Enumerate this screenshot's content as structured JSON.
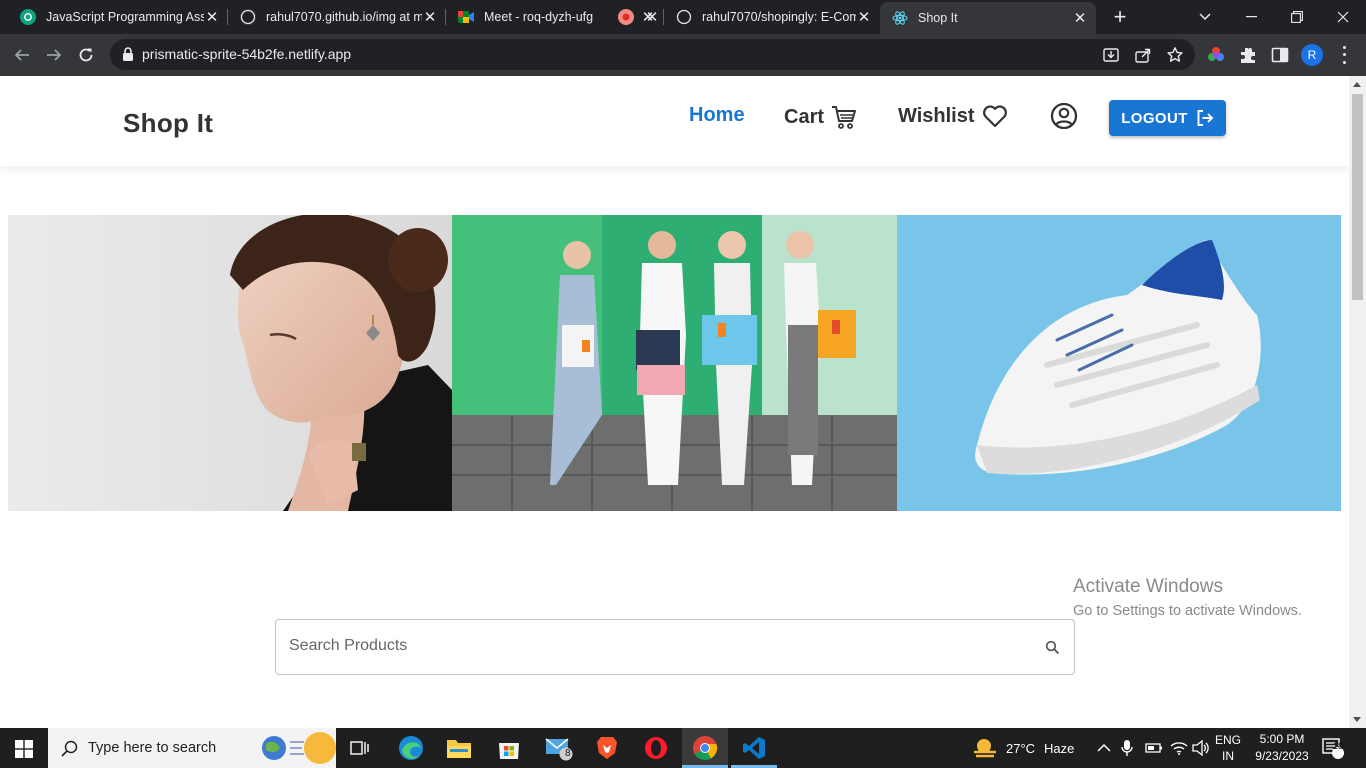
{
  "browser": {
    "tabs": [
      {
        "title": "JavaScript Programming Assi",
        "icon": "chatgpt-icon"
      },
      {
        "title": "rahul7070.github.io/img at m",
        "icon": "github-icon"
      },
      {
        "title": "Meet - roq-dyzh-ufg",
        "icon": "google-meet-icon"
      },
      {
        "title": "",
        "icon": "recording-icon"
      },
      {
        "title": "rahul7070/shopingly: E-Comr",
        "icon": "github-icon"
      },
      {
        "title": "Shop It",
        "icon": "react-icon",
        "active": true
      }
    ],
    "url": "prismatic-sprite-54b2fe.netlify.app",
    "profile_initial": "R"
  },
  "site": {
    "brand": "Shop It",
    "nav": {
      "home": "Home",
      "cart": "Cart",
      "wishlist": "Wishlist",
      "logout": "LOGOUT"
    },
    "banner_images": [
      {
        "subject": "woman-wearing-jewelry"
      },
      {
        "subject": "friends-with-shopping-bags"
      },
      {
        "subject": "white-sneaker"
      }
    ],
    "search": {
      "placeholder": "Search Products"
    },
    "colors": {
      "primary": "#1976d2",
      "text": "#333333"
    }
  },
  "watermark": {
    "line1": "Activate Windows",
    "line2": "Go to Settings to activate Windows."
  },
  "taskbar": {
    "search_text": "Type here to search",
    "mail_badge": "8",
    "weather": {
      "temp": "27°C",
      "condition": "Haze"
    },
    "lang": {
      "top": "ENG",
      "bottom": "IN"
    },
    "time": "5:00 PM",
    "date": "9/23/2023",
    "notifications": "18"
  }
}
